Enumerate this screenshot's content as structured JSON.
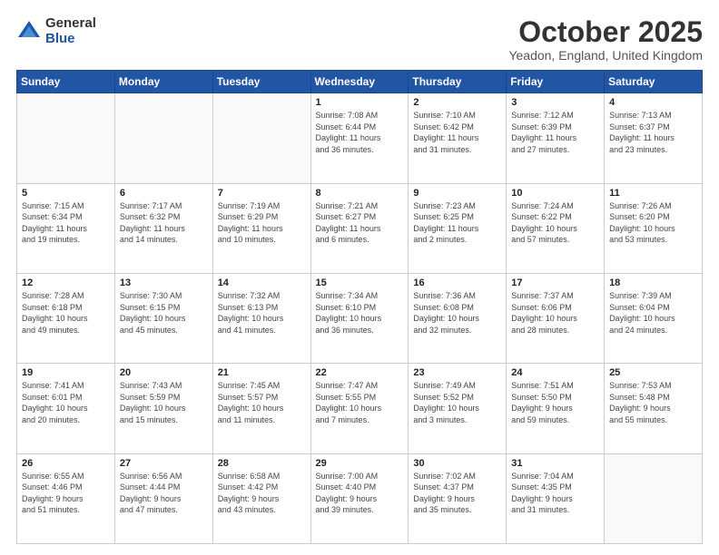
{
  "logo": {
    "general": "General",
    "blue": "Blue"
  },
  "header": {
    "month": "October 2025",
    "location": "Yeadon, England, United Kingdom"
  },
  "weekdays": [
    "Sunday",
    "Monday",
    "Tuesday",
    "Wednesday",
    "Thursday",
    "Friday",
    "Saturday"
  ],
  "weeks": [
    [
      {
        "day": "",
        "info": ""
      },
      {
        "day": "",
        "info": ""
      },
      {
        "day": "",
        "info": ""
      },
      {
        "day": "1",
        "info": "Sunrise: 7:08 AM\nSunset: 6:44 PM\nDaylight: 11 hours\nand 36 minutes."
      },
      {
        "day": "2",
        "info": "Sunrise: 7:10 AM\nSunset: 6:42 PM\nDaylight: 11 hours\nand 31 minutes."
      },
      {
        "day": "3",
        "info": "Sunrise: 7:12 AM\nSunset: 6:39 PM\nDaylight: 11 hours\nand 27 minutes."
      },
      {
        "day": "4",
        "info": "Sunrise: 7:13 AM\nSunset: 6:37 PM\nDaylight: 11 hours\nand 23 minutes."
      }
    ],
    [
      {
        "day": "5",
        "info": "Sunrise: 7:15 AM\nSunset: 6:34 PM\nDaylight: 11 hours\nand 19 minutes."
      },
      {
        "day": "6",
        "info": "Sunrise: 7:17 AM\nSunset: 6:32 PM\nDaylight: 11 hours\nand 14 minutes."
      },
      {
        "day": "7",
        "info": "Sunrise: 7:19 AM\nSunset: 6:29 PM\nDaylight: 11 hours\nand 10 minutes."
      },
      {
        "day": "8",
        "info": "Sunrise: 7:21 AM\nSunset: 6:27 PM\nDaylight: 11 hours\nand 6 minutes."
      },
      {
        "day": "9",
        "info": "Sunrise: 7:23 AM\nSunset: 6:25 PM\nDaylight: 11 hours\nand 2 minutes."
      },
      {
        "day": "10",
        "info": "Sunrise: 7:24 AM\nSunset: 6:22 PM\nDaylight: 10 hours\nand 57 minutes."
      },
      {
        "day": "11",
        "info": "Sunrise: 7:26 AM\nSunset: 6:20 PM\nDaylight: 10 hours\nand 53 minutes."
      }
    ],
    [
      {
        "day": "12",
        "info": "Sunrise: 7:28 AM\nSunset: 6:18 PM\nDaylight: 10 hours\nand 49 minutes."
      },
      {
        "day": "13",
        "info": "Sunrise: 7:30 AM\nSunset: 6:15 PM\nDaylight: 10 hours\nand 45 minutes."
      },
      {
        "day": "14",
        "info": "Sunrise: 7:32 AM\nSunset: 6:13 PM\nDaylight: 10 hours\nand 41 minutes."
      },
      {
        "day": "15",
        "info": "Sunrise: 7:34 AM\nSunset: 6:10 PM\nDaylight: 10 hours\nand 36 minutes."
      },
      {
        "day": "16",
        "info": "Sunrise: 7:36 AM\nSunset: 6:08 PM\nDaylight: 10 hours\nand 32 minutes."
      },
      {
        "day": "17",
        "info": "Sunrise: 7:37 AM\nSunset: 6:06 PM\nDaylight: 10 hours\nand 28 minutes."
      },
      {
        "day": "18",
        "info": "Sunrise: 7:39 AM\nSunset: 6:04 PM\nDaylight: 10 hours\nand 24 minutes."
      }
    ],
    [
      {
        "day": "19",
        "info": "Sunrise: 7:41 AM\nSunset: 6:01 PM\nDaylight: 10 hours\nand 20 minutes."
      },
      {
        "day": "20",
        "info": "Sunrise: 7:43 AM\nSunset: 5:59 PM\nDaylight: 10 hours\nand 15 minutes."
      },
      {
        "day": "21",
        "info": "Sunrise: 7:45 AM\nSunset: 5:57 PM\nDaylight: 10 hours\nand 11 minutes."
      },
      {
        "day": "22",
        "info": "Sunrise: 7:47 AM\nSunset: 5:55 PM\nDaylight: 10 hours\nand 7 minutes."
      },
      {
        "day": "23",
        "info": "Sunrise: 7:49 AM\nSunset: 5:52 PM\nDaylight: 10 hours\nand 3 minutes."
      },
      {
        "day": "24",
        "info": "Sunrise: 7:51 AM\nSunset: 5:50 PM\nDaylight: 9 hours\nand 59 minutes."
      },
      {
        "day": "25",
        "info": "Sunrise: 7:53 AM\nSunset: 5:48 PM\nDaylight: 9 hours\nand 55 minutes."
      }
    ],
    [
      {
        "day": "26",
        "info": "Sunrise: 6:55 AM\nSunset: 4:46 PM\nDaylight: 9 hours\nand 51 minutes."
      },
      {
        "day": "27",
        "info": "Sunrise: 6:56 AM\nSunset: 4:44 PM\nDaylight: 9 hours\nand 47 minutes."
      },
      {
        "day": "28",
        "info": "Sunrise: 6:58 AM\nSunset: 4:42 PM\nDaylight: 9 hours\nand 43 minutes."
      },
      {
        "day": "29",
        "info": "Sunrise: 7:00 AM\nSunset: 4:40 PM\nDaylight: 9 hours\nand 39 minutes."
      },
      {
        "day": "30",
        "info": "Sunrise: 7:02 AM\nSunset: 4:37 PM\nDaylight: 9 hours\nand 35 minutes."
      },
      {
        "day": "31",
        "info": "Sunrise: 7:04 AM\nSunset: 4:35 PM\nDaylight: 9 hours\nand 31 minutes."
      },
      {
        "day": "",
        "info": ""
      }
    ]
  ]
}
